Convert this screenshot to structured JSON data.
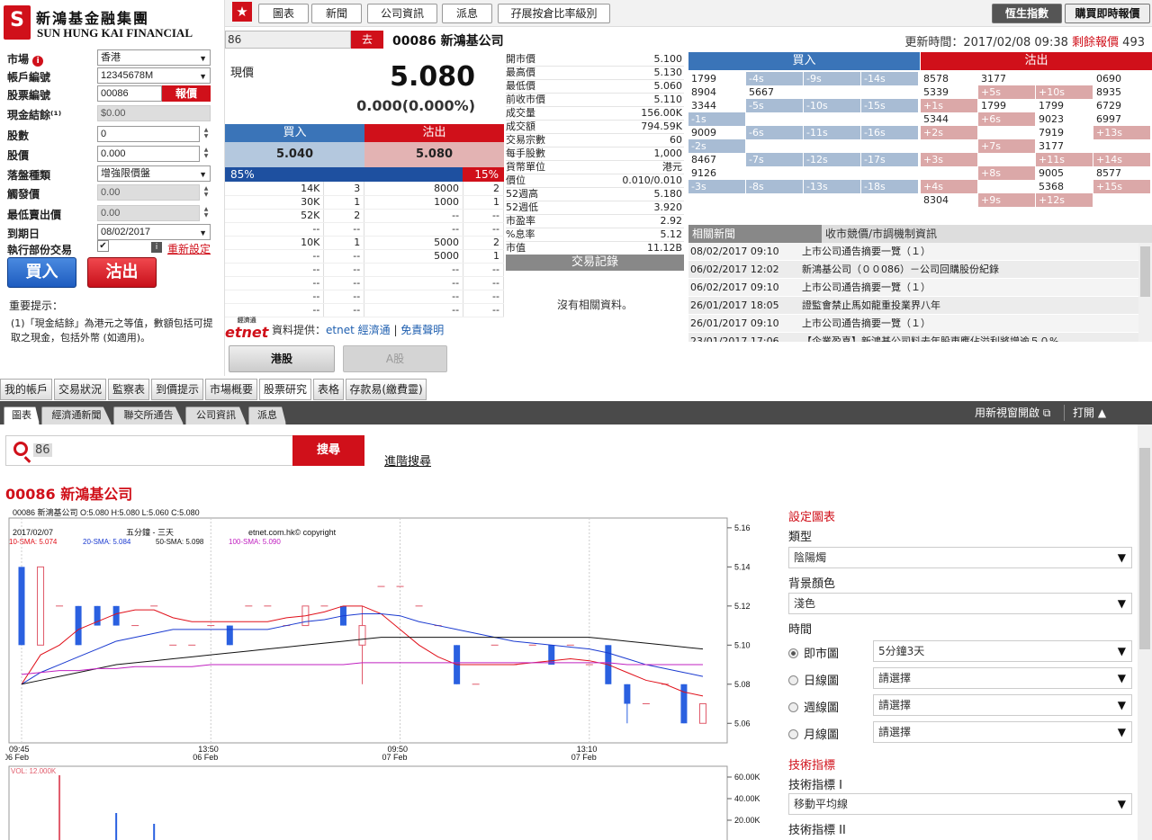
{
  "brand": {
    "mark": "S",
    "name_cn": "新鴻基金融集團",
    "name_en": "SUN HUNG KAI FINANCIAL"
  },
  "order_form": {
    "market": {
      "label": "市場",
      "value": "香港"
    },
    "account": {
      "label": "帳戶編號",
      "value": "12345678M"
    },
    "stock": {
      "label": "股票編號",
      "value": "00086",
      "quote_button": "報價"
    },
    "cash": {
      "label": "現金結餘⁽¹⁾",
      "value": "$0.00"
    },
    "qty": {
      "label": "股數",
      "value": "0"
    },
    "price": {
      "label": "股價",
      "value": "0.000"
    },
    "order_type": {
      "label": "落盤種類",
      "value": "增強限價盤"
    },
    "trigger": {
      "label": "觸發價",
      "value": "0.00"
    },
    "min_sell": {
      "label": "最低賣出價",
      "value": "0.00"
    },
    "expiry": {
      "label": "到期日",
      "value": "08/02/2017"
    },
    "partial": {
      "label": "執行部份交易",
      "checked": "✔",
      "reset": "重新設定"
    },
    "buy_label": "買入",
    "sell_label": "沽出",
    "notes_title": "重要提示：",
    "notes_text": "(1)「現金結餘」為港元之等值，數額包括可提取之現金，包括外幣 (如適用)。"
  },
  "toolbar": {
    "star": "★",
    "tabs": [
      "圖表",
      "新聞",
      "公司資訊",
      "派息",
      "孖展按倉比率級別"
    ],
    "index_button": "恆生指數",
    "buy_quote_button": "購買即時報價"
  },
  "search": {
    "value": "86",
    "go": "去",
    "title": "00086 新鴻基公司",
    "update_label": "更新時間：2017/02/08 09:38",
    "quota_label": "剩餘報價",
    "quota_value": "493"
  },
  "quote": {
    "label": "現價",
    "price": "5.080",
    "change": "0.000(0.000%)",
    "bid_label": "買入",
    "ask_label": "沽出",
    "bid": "5.040",
    "ask": "5.080",
    "bid_pct": "85%",
    "ask_pct": "15%",
    "bid_ratio": 0.85
  },
  "depth": [
    [
      "14K",
      "3",
      "8000",
      "2"
    ],
    [
      "30K",
      "1",
      "1000",
      "1"
    ],
    [
      "52K",
      "2",
      "--",
      "--"
    ],
    [
      "--",
      "--",
      "--",
      "--"
    ],
    [
      "10K",
      "1",
      "5000",
      "2"
    ],
    [
      "--",
      "--",
      "5000",
      "1"
    ],
    [
      "--",
      "--",
      "--",
      "--"
    ],
    [
      "--",
      "--",
      "--",
      "--"
    ],
    [
      "--",
      "--",
      "--",
      "--"
    ],
    [
      "--",
      "--",
      "--",
      "--"
    ]
  ],
  "stats": [
    [
      "開市價",
      "5.100"
    ],
    [
      "最高價",
      "5.130"
    ],
    [
      "最低價",
      "5.060"
    ],
    [
      "前收市價",
      "5.110"
    ],
    [
      "成交量",
      "156.00K"
    ],
    [
      "成交額",
      "794.59K"
    ],
    [
      "交易宗數",
      "60"
    ],
    [
      "每手股數",
      "1,000"
    ],
    [
      "貨幣單位",
      "港元"
    ],
    [
      "價位",
      "0.010/0.010"
    ],
    [
      "52週高",
      "5.180"
    ],
    [
      "52週低",
      "3.920"
    ],
    [
      "市盈率",
      "2.92"
    ],
    [
      "%息率",
      "5.12"
    ],
    [
      "市值",
      "11.12B"
    ]
  ],
  "trades": {
    "title": "交易記錄",
    "empty": "沒有相關資料。"
  },
  "provider": {
    "logo": "etnet",
    "logo_cn": "經濟通",
    "text": "資料提供：",
    "link1": "etnet 經濟通",
    "sep": " | ",
    "link2": "免責聲明"
  },
  "broker": {
    "buy_label": "買入",
    "sell_label": "沽出",
    "buy_rows": [
      [
        "1799",
        "-4s",
        "-9s",
        "-14s"
      ],
      [
        "8904",
        "5667",
        "",
        ""
      ],
      [
        "3344",
        "-5s",
        "-10s",
        "-15s"
      ],
      [
        "-1s",
        "",
        "",
        ""
      ],
      [
        "9009",
        "-6s",
        "-11s",
        "-16s"
      ],
      [
        "-2s",
        "",
        "",
        ""
      ],
      [
        "8467",
        "-7s",
        "-12s",
        "-17s"
      ],
      [
        "9126",
        "",
        "",
        ""
      ],
      [
        "-3s",
        "-8s",
        "-13s",
        "-18s"
      ]
    ],
    "sell_rows": [
      [
        "8578",
        "3177",
        "",
        "0690"
      ],
      [
        "5339",
        "+5s",
        "+10s",
        "8935"
      ],
      [
        "+1s",
        "1799",
        "1799",
        "6729"
      ],
      [
        "5344",
        "+6s",
        "9023",
        "6997"
      ],
      [
        "+2s",
        "",
        "7919",
        "+13s"
      ],
      [
        "",
        "+7s",
        "3177",
        ""
      ],
      [
        "+3s",
        "",
        "+11s",
        "+14s"
      ],
      [
        "",
        "+8s",
        "9005",
        "8577"
      ],
      [
        "+4s",
        "",
        "5368",
        "+15s"
      ],
      [
        "8304",
        "+9s",
        "+12s",
        ""
      ]
    ]
  },
  "news": {
    "tab1": "相關新聞",
    "tab2": "收市競價/市調機制資訊",
    "items": [
      [
        "08/02/2017 09:10",
        "上市公司通告摘要一覽（１）"
      ],
      [
        "06/02/2017 12:02",
        "新鴻基公司（００086）－公司回購股份紀錄"
      ],
      [
        "06/02/2017 09:10",
        "上市公司通告摘要一覽（１）"
      ],
      [
        "26/01/2017 18:05",
        "證監會禁止馬如龍重投業界八年"
      ],
      [
        "26/01/2017 09:10",
        "上市公司通告摘要一覽（１）"
      ],
      [
        "23/01/2017 17:06",
        "【企業盈喜】新鴻基公司料去年股東應佔溢利將增逾５０%"
      ]
    ]
  },
  "market_tabs": {
    "hk": "港股",
    "a": "A股"
  },
  "main_tabs": [
    "我的帳戶",
    "交易狀況",
    "監察表",
    "到價提示",
    "市場概要",
    "股票研究",
    "表格",
    "存款易(繳費靈)"
  ],
  "sub_tabs": [
    "圖表",
    "經濟通新聞",
    "聯交所通告",
    "公司資訊",
    "派息"
  ],
  "sub_right": {
    "popout": "用新視窗開啟 ⧉",
    "toggle": "打開 ▲"
  },
  "chart_search": {
    "value": "86",
    "button": "搜尋",
    "advanced": "進階搜尋",
    "title": "00086 新鴻基公司"
  },
  "chart_data": {
    "type": "candlestick",
    "header": "00086  新鴻基公司  O:5.080  H:5.080  L:5.060  C:5.080",
    "date_label": "2017/02/07",
    "period_label": "五分鐘 - 三天",
    "copyright": "etnet.com.hk© copyright",
    "sma_labels": [
      {
        "name": "10-SMA: 5.074",
        "color": "#e0101a"
      },
      {
        "name": "20-SMA: 5.084",
        "color": "#1a3ad0"
      },
      {
        "name": "50-SMA: 5.098",
        "color": "#111111"
      },
      {
        "name": "100-SMA: 5.090",
        "color": "#c020c0"
      }
    ],
    "ylim": [
      5.05,
      5.165
    ],
    "yticks": [
      "5.16",
      "5.14",
      "5.12",
      "5.10",
      "5.08",
      "5.06"
    ],
    "xticks": [
      {
        "t": "09:45",
        "d": "06 Feb"
      },
      {
        "t": "13:50",
        "d": "06 Feb"
      },
      {
        "t": "09:50",
        "d": "07 Feb"
      },
      {
        "t": "13:10",
        "d": "07 Feb"
      }
    ],
    "candles": [
      {
        "o": 5.14,
        "c": 5.1,
        "h": 5.14,
        "l": 5.1
      },
      {
        "o": 5.1,
        "c": 5.14,
        "h": 5.14,
        "l": 5.1
      },
      {
        "o": 5.12,
        "c": 5.12,
        "h": 5.12,
        "l": 5.12
      },
      {
        "o": 5.12,
        "c": 5.1,
        "h": 5.12,
        "l": 5.1
      },
      {
        "o": 5.12,
        "c": 5.11,
        "h": 5.12,
        "l": 5.11
      },
      {
        "o": 5.12,
        "c": 5.11,
        "h": 5.12,
        "l": 5.11
      },
      {
        "o": 5.11,
        "c": 5.11,
        "h": 5.11,
        "l": 5.11
      },
      {
        "o": 5.12,
        "c": 5.12,
        "h": 5.12,
        "l": 5.12
      },
      {
        "o": 5.1,
        "c": 5.1,
        "h": 5.1,
        "l": 5.1
      },
      {
        "o": 5.1,
        "c": 5.1,
        "h": 5.1,
        "l": 5.1
      },
      {
        "o": 5.11,
        "c": 5.11,
        "h": 5.11,
        "l": 5.11
      },
      {
        "o": 5.11,
        "c": 5.1,
        "h": 5.11,
        "l": 5.1
      },
      {
        "o": 5.12,
        "c": 5.12,
        "h": 5.12,
        "l": 5.12
      },
      {
        "o": 5.12,
        "c": 5.12,
        "h": 5.12,
        "l": 5.12
      },
      {
        "o": 5.11,
        "c": 5.11,
        "h": 5.11,
        "l": 5.11
      },
      {
        "o": 5.11,
        "c": 5.12,
        "h": 5.12,
        "l": 5.11
      },
      {
        "o": 5.12,
        "c": 5.12,
        "h": 5.12,
        "l": 5.12
      },
      {
        "o": 5.12,
        "c": 5.11,
        "h": 5.12,
        "l": 5.11
      },
      {
        "o": 5.1,
        "c": 5.11,
        "h": 5.12,
        "l": 5.08
      },
      {
        "o": 5.13,
        "c": 5.13,
        "h": 5.13,
        "l": 5.13
      },
      {
        "o": 5.13,
        "c": 5.13,
        "h": 5.13,
        "l": 5.13
      },
      {
        "o": 5.12,
        "c": 5.12,
        "h": 5.12,
        "l": 5.12
      },
      {
        "o": 5.11,
        "c": 5.11,
        "h": 5.11,
        "l": 5.11
      },
      {
        "o": 5.1,
        "c": 5.08,
        "h": 5.1,
        "l": 5.08
      },
      {
        "o": 5.08,
        "c": 5.08,
        "h": 5.08,
        "l": 5.08
      },
      {
        "o": 5.1,
        "c": 5.1,
        "h": 5.1,
        "l": 5.1
      },
      {
        "o": 5.09,
        "c": 5.09,
        "h": 5.09,
        "l": 5.09
      },
      {
        "o": 5.1,
        "c": 5.1,
        "h": 5.1,
        "l": 5.1
      },
      {
        "o": 5.1,
        "c": 5.09,
        "h": 5.1,
        "l": 5.09
      },
      {
        "o": 5.1,
        "c": 5.1,
        "h": 5.1,
        "l": 5.1
      },
      {
        "o": 5.09,
        "c": 5.09,
        "h": 5.09,
        "l": 5.09
      },
      {
        "o": 5.1,
        "c": 5.08,
        "h": 5.1,
        "l": 5.08
      },
      {
        "o": 5.08,
        "c": 5.07,
        "h": 5.08,
        "l": 5.06
      },
      {
        "o": 5.07,
        "c": 5.07,
        "h": 5.07,
        "l": 5.07
      },
      {
        "o": 5.08,
        "c": 5.08,
        "h": 5.08,
        "l": 5.08
      },
      {
        "o": 5.08,
        "c": 5.06,
        "h": 5.08,
        "l": 5.06
      },
      {
        "o": 5.06,
        "c": 5.07,
        "h": 5.07,
        "l": 5.06
      }
    ],
    "sma10": [
      5.08,
      5.095,
      5.1,
      5.108,
      5.112,
      5.116,
      5.118,
      5.118,
      5.114,
      5.112,
      5.112,
      5.112,
      5.112,
      5.112,
      5.114,
      5.115,
      5.117,
      5.12,
      5.12,
      5.116,
      5.108,
      5.1,
      5.094,
      5.09,
      5.09,
      5.09,
      5.09,
      5.091,
      5.092,
      5.093,
      5.092,
      5.09,
      5.086,
      5.082,
      5.08,
      5.076,
      5.074
    ],
    "sma20": [
      5.08,
      5.086,
      5.09,
      5.094,
      5.098,
      5.102,
      5.104,
      5.106,
      5.108,
      5.108,
      5.108,
      5.108,
      5.108,
      5.108,
      5.11,
      5.112,
      5.113,
      5.115,
      5.116,
      5.116,
      5.115,
      5.112,
      5.11,
      5.108,
      5.106,
      5.104,
      5.102,
      5.101,
      5.1,
      5.099,
      5.098,
      5.096,
      5.093,
      5.09,
      5.088,
      5.086,
      5.084
    ],
    "sma50": [
      5.08,
      5.082,
      5.084,
      5.086,
      5.088,
      5.09,
      5.091,
      5.092,
      5.093,
      5.094,
      5.095,
      5.096,
      5.097,
      5.098,
      5.099,
      5.1,
      5.101,
      5.102,
      5.103,
      5.104,
      5.104,
      5.104,
      5.104,
      5.104,
      5.104,
      5.104,
      5.104,
      5.104,
      5.104,
      5.104,
      5.104,
      5.103,
      5.102,
      5.101,
      5.1,
      5.099,
      5.098
    ],
    "sma100": [
      5.085,
      5.086,
      5.087,
      5.087,
      5.088,
      5.088,
      5.089,
      5.089,
      5.089,
      5.089,
      5.09,
      5.09,
      5.09,
      5.09,
      5.09,
      5.09,
      5.09,
      5.09,
      5.091,
      5.091,
      5.091,
      5.091,
      5.091,
      5.091,
      5.091,
      5.091,
      5.091,
      5.091,
      5.091,
      5.091,
      5.091,
      5.091,
      5.09,
      5.09,
      5.09,
      5.09,
      5.09
    ],
    "volume": {
      "label": "VOL: 12.000K",
      "yticks": [
        "60.00K",
        "40.00K",
        "20.00K"
      ],
      "bars": [
        0,
        0,
        0,
        0,
        0,
        0,
        0,
        0,
        0,
        0,
        0,
        0,
        0,
        0,
        0,
        0,
        0,
        0,
        0,
        0,
        0,
        0,
        0,
        0,
        0,
        0,
        0,
        0,
        0,
        0,
        0,
        0,
        0,
        0,
        0,
        0,
        0
      ]
    }
  },
  "settings": {
    "title": "設定圖表",
    "type_label": "類型",
    "type_value": "陰陽燭",
    "bg_label": "背景顏色",
    "bg_value": "淺色",
    "time_label": "時間",
    "radios": [
      {
        "label": "即市圖",
        "value": "5分鐘3天",
        "on": true
      },
      {
        "label": "日線圖",
        "value": "請選擇",
        "on": false
      },
      {
        "label": "週線圖",
        "value": "請選擇",
        "on": false
      },
      {
        "label": "月線圖",
        "value": "請選擇",
        "on": false
      }
    ],
    "tech_title": "技術指標",
    "tech1_label": "技術指標 I",
    "tech1_value": "移動平均線",
    "tech2_label": "技術指標 II"
  }
}
